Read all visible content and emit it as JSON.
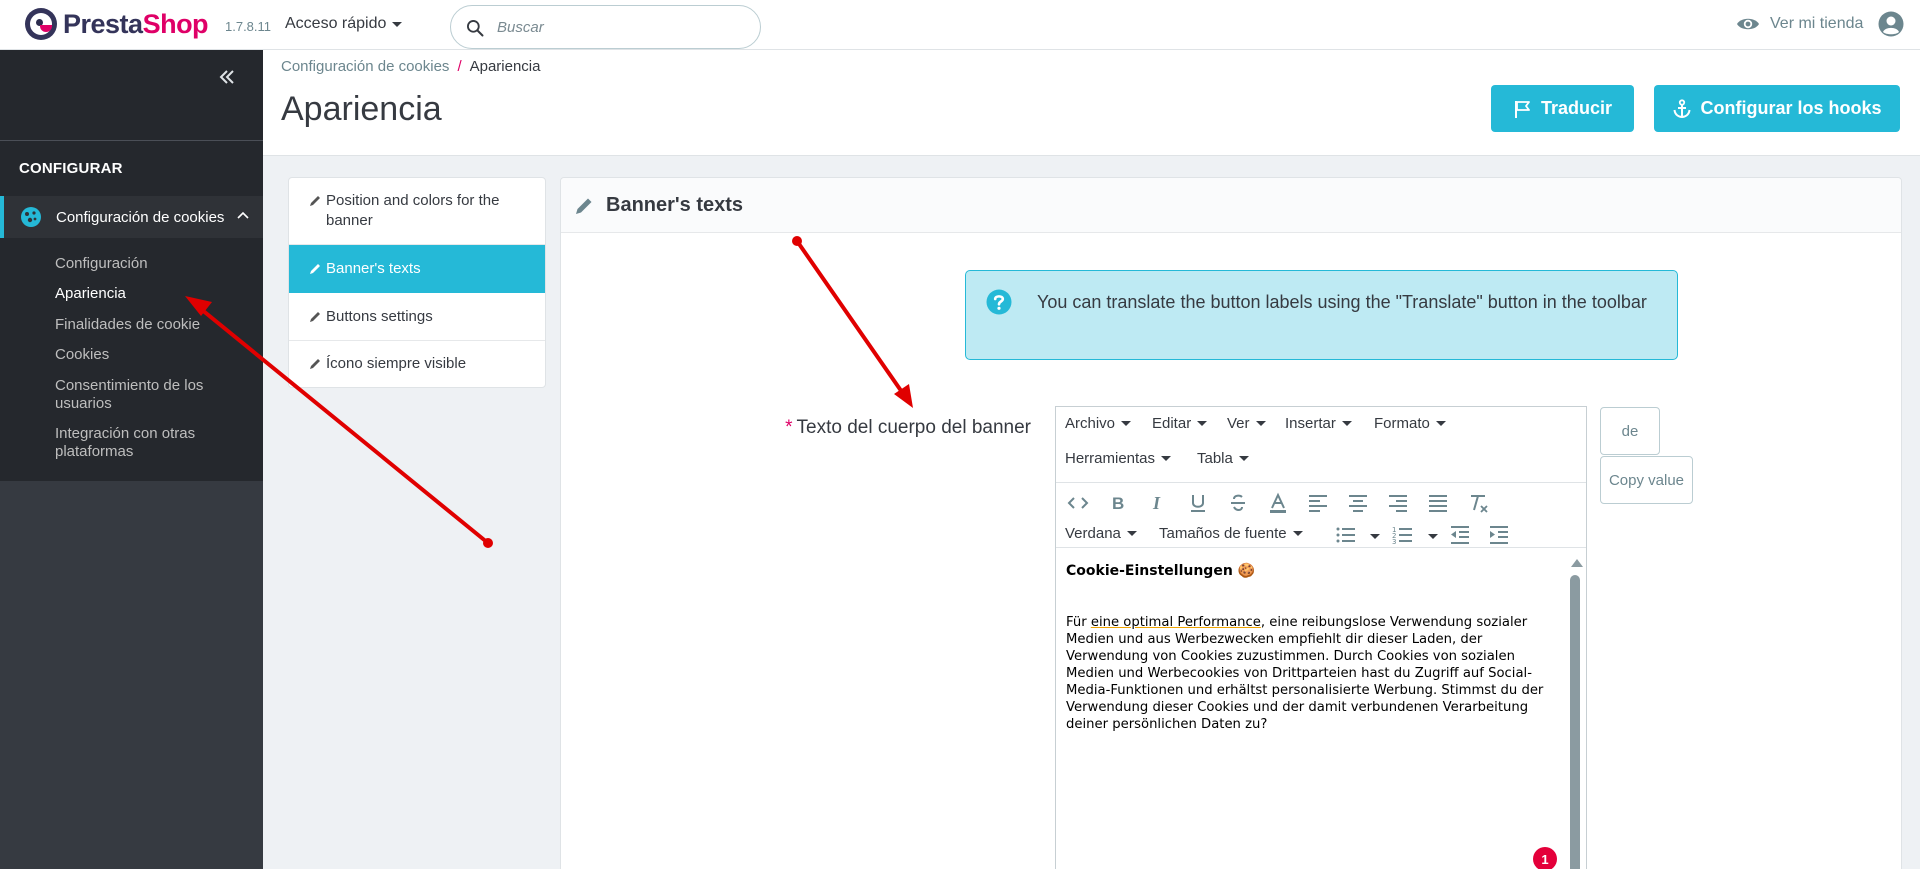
{
  "header": {
    "brand_a": "Presta",
    "brand_b": "Shop",
    "version": "1.7.8.11",
    "quick_access": "Acceso rápido",
    "search_placeholder": "Buscar",
    "view_store": "Ver mi tienda"
  },
  "sidebar": {
    "section": "CONFIGURAR",
    "active_module": "Configuración de cookies",
    "items": [
      {
        "label": "Configuración"
      },
      {
        "label": "Apariencia"
      },
      {
        "label": "Finalidades de cookie"
      },
      {
        "label": "Cookies"
      },
      {
        "label": "Consentimiento de los usuarios"
      },
      {
        "label": "Integración con otras plataformas"
      }
    ]
  },
  "page": {
    "breadcrumb_parent": "Configuración de cookies",
    "breadcrumb_sep": "/",
    "breadcrumb_current": "Apariencia",
    "title": "Apariencia",
    "translate_button": "Traducir",
    "hooks_button": "Configurar los hooks"
  },
  "tabs": [
    {
      "label": "Position and colors for the banner"
    },
    {
      "label": "Banner's texts"
    },
    {
      "label": "Buttons settings"
    },
    {
      "label": "Ícono siempre visible"
    }
  ],
  "panel": {
    "title": "Banner's texts",
    "alert": "You can translate the button labels using the \"Translate\" button in the toolbar",
    "field_required": "*",
    "field_label": "Texto del cuerpo del banner",
    "lang_button": "de",
    "copy_button": "Copy value"
  },
  "editor": {
    "menus": [
      "Archivo",
      "Editar",
      "Ver",
      "Insertar",
      "Formato",
      "Herramientas",
      "Tabla"
    ],
    "font_family": "Verdana",
    "font_size": "Tamaños de fuente",
    "content_heading": "Cookie-Einstellungen 🍪",
    "content_pre": "Für ",
    "content_spell": "eine optimal Performance",
    "content_post": ", eine reibungslose Verwendung sozialer Medien und aus Werbezwecken empfiehlt dir dieser Laden, der Verwendung von Cookies zuzustimmen. Durch Cookies von sozialen Medien und Werbecookies von Drittparteien hast du Zugriff auf Social-Media-Funktionen und erhältst personalisierte Werbung. Stimmst du der Verwendung dieser Cookies und der damit verbundenen Verarbeitung deiner persönlichen Daten zu?",
    "badge": "1"
  },
  "colors": {
    "accent": "#25b9d7",
    "brand": "#df0067",
    "sidebar_bg": "#363a41",
    "arrow": "#e00000"
  }
}
